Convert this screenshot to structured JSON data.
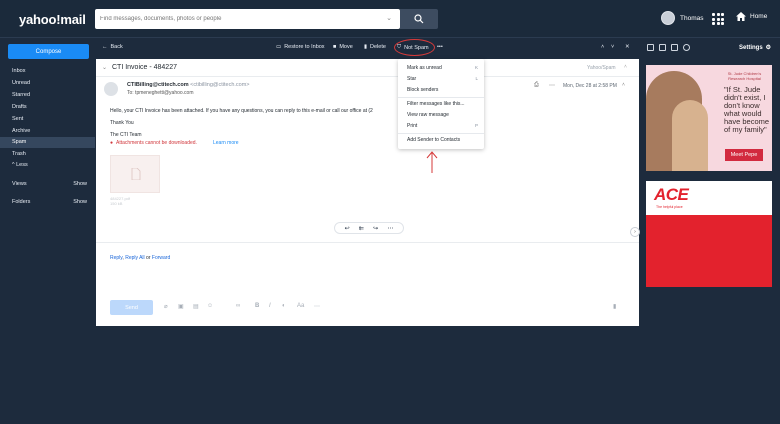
{
  "header": {
    "logo": "yahoo!mail",
    "search_placeholder": "Find messages, documents, photos or people",
    "user_name": "Thomas",
    "home_label": "Home"
  },
  "sidebar": {
    "compose_label": "Compose",
    "folders": [
      "Inbox",
      "Unread",
      "Starred",
      "Drafts",
      "Sent",
      "Archive",
      "Spam",
      "Trash",
      "^ Less"
    ],
    "active_folder": "Spam",
    "views_label": "Views",
    "views_action": "Show",
    "folders_label": "Folders",
    "folders_action": "Show"
  },
  "toolbar": {
    "back": "Back",
    "restore": "Restore to Inbox",
    "move": "Move",
    "delete": "Delete",
    "not_spam": "Not Spam",
    "more": "•••"
  },
  "email": {
    "subject": "CTI Invoice - 484227",
    "folder_tag": "Yahoo/Spam",
    "sender_name": "CTIBilling@ctitech.com",
    "sender_addr": "<ctibilling@ctitech.com>",
    "to_line": "To: tpmeneghetti@yahoo.com",
    "date": "Mon, Dec 28 at 2:58 PM",
    "body_line1": "Hello, your CTI Invoice has been attached.  If you have any questions, you can reply to this e-mail or call our office at (2",
    "body_line2": "Thank You",
    "body_line3": "The CTI Team",
    "attach_warning": "Attachments cannot be downloaded.",
    "learn_more": "Learn more",
    "attach_name": "484227.pdf",
    "attach_size": "150 kB",
    "reply": "Reply",
    "reply_all": "Reply All",
    "or": "or",
    "forward": "Forward",
    "send_label": "Send"
  },
  "menu": {
    "items": [
      {
        "label": "Mark as unread",
        "key": "K"
      },
      {
        "label": "Star",
        "key": "L"
      },
      {
        "label": "Block senders",
        "key": ""
      },
      {
        "label": "Filter messages like this...",
        "key": ""
      },
      {
        "label": "View raw message",
        "key": ""
      },
      {
        "label": "Print",
        "key": "P"
      },
      {
        "label": "Add Sender to Contacts",
        "key": ""
      }
    ]
  },
  "right_rail": {
    "settings_label": "Settings",
    "ad1_logo": "St. Jude Children's Research Hospital",
    "ad1_quote": "\"If St. Jude didn't exist, I don't know what would have become of my family\"",
    "ad1_button": "Meet Pepe",
    "ad2_logo": "ACE",
    "ad2_sub": "The helpful place"
  },
  "colors": {
    "accent": "#1a8bf5",
    "background": "#1d2b3d",
    "annotation": "#d63a3a"
  }
}
